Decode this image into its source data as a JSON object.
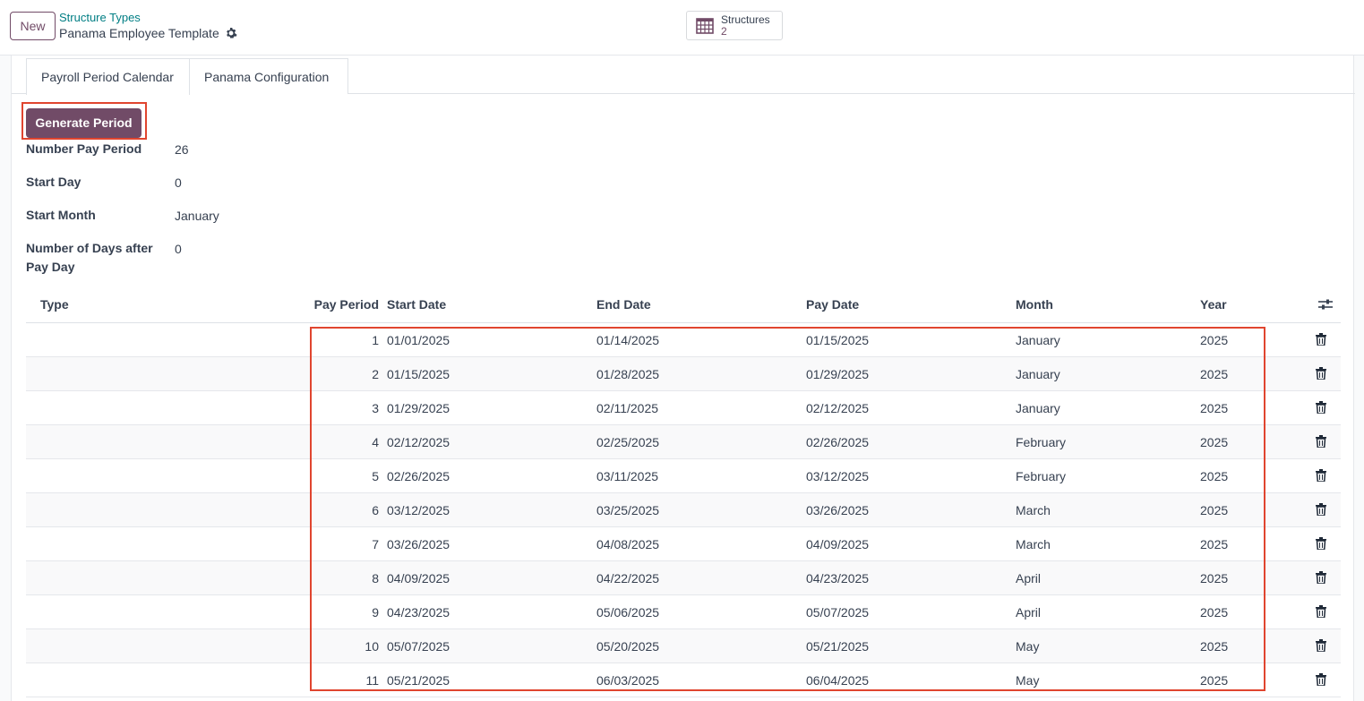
{
  "header": {
    "new_label": "New",
    "breadcrumb_parent": "Structure Types",
    "breadcrumb_current": "Panama Employee Template",
    "smart_button": {
      "label": "Structures",
      "value": "2"
    }
  },
  "tabs": [
    {
      "label": "Payroll Period Calendar",
      "active": true
    },
    {
      "label": "Panama Configuration",
      "active": false
    }
  ],
  "actions": {
    "generate_label": "Generate Period"
  },
  "fields": [
    {
      "label": "Number Pay Period",
      "value": "26"
    },
    {
      "label": "Start Day",
      "value": "0"
    },
    {
      "label": "Start Month",
      "value": "January"
    },
    {
      "label": "Number of Days after Pay Day",
      "value": "0"
    }
  ],
  "table": {
    "columns": [
      "Type",
      "Pay Period",
      "Start Date",
      "End Date",
      "Pay Date",
      "Month",
      "Year"
    ],
    "rows": [
      {
        "type": "",
        "period": "1",
        "start": "01/01/2025",
        "end": "01/14/2025",
        "pay": "01/15/2025",
        "month": "January",
        "year": "2025"
      },
      {
        "type": "",
        "period": "2",
        "start": "01/15/2025",
        "end": "01/28/2025",
        "pay": "01/29/2025",
        "month": "January",
        "year": "2025"
      },
      {
        "type": "",
        "period": "3",
        "start": "01/29/2025",
        "end": "02/11/2025",
        "pay": "02/12/2025",
        "month": "January",
        "year": "2025"
      },
      {
        "type": "",
        "period": "4",
        "start": "02/12/2025",
        "end": "02/25/2025",
        "pay": "02/26/2025",
        "month": "February",
        "year": "2025"
      },
      {
        "type": "",
        "period": "5",
        "start": "02/26/2025",
        "end": "03/11/2025",
        "pay": "03/12/2025",
        "month": "February",
        "year": "2025"
      },
      {
        "type": "",
        "period": "6",
        "start": "03/12/2025",
        "end": "03/25/2025",
        "pay": "03/26/2025",
        "month": "March",
        "year": "2025"
      },
      {
        "type": "",
        "period": "7",
        "start": "03/26/2025",
        "end": "04/08/2025",
        "pay": "04/09/2025",
        "month": "March",
        "year": "2025"
      },
      {
        "type": "",
        "period": "8",
        "start": "04/09/2025",
        "end": "04/22/2025",
        "pay": "04/23/2025",
        "month": "April",
        "year": "2025"
      },
      {
        "type": "",
        "period": "9",
        "start": "04/23/2025",
        "end": "05/06/2025",
        "pay": "05/07/2025",
        "month": "April",
        "year": "2025"
      },
      {
        "type": "",
        "period": "10",
        "start": "05/07/2025",
        "end": "05/20/2025",
        "pay": "05/21/2025",
        "month": "May",
        "year": "2025"
      },
      {
        "type": "",
        "period": "11",
        "start": "05/21/2025",
        "end": "06/03/2025",
        "pay": "06/04/2025",
        "month": "May",
        "year": "2025"
      }
    ]
  },
  "icons": {
    "gear": "gear-icon",
    "calendar": "calendar-grid-icon",
    "column_settings": "sliders-icon",
    "delete": "trash-icon"
  },
  "colors": {
    "primary": "#714b67",
    "link": "#017e84",
    "highlight": "#e0452f"
  }
}
